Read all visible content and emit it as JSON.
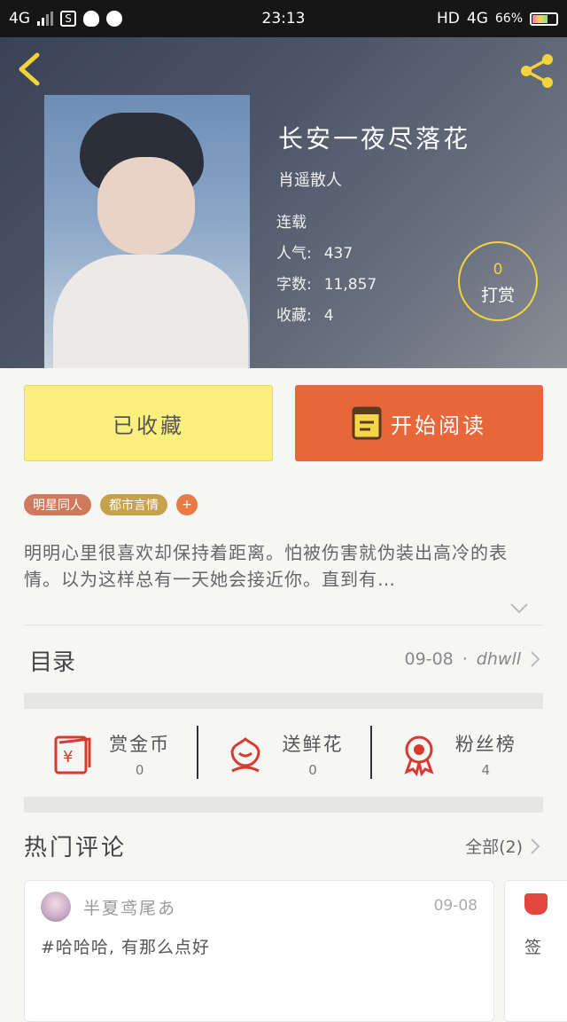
{
  "status_bar": {
    "network_left": "4G",
    "time": "23:13",
    "hd": "HD",
    "network_right": "4G",
    "battery": "66%",
    "battery_level": 0.66,
    "app_icon_1": "S"
  },
  "header": {
    "back_icon": "chevron-left-icon",
    "share_icon": "share-icon"
  },
  "book": {
    "title": "长安一夜尽落花",
    "author": "肖遥散人",
    "status": "连载",
    "popularity_label": "人气:",
    "popularity": "437",
    "words_label": "字数:",
    "words": "11,857",
    "favorites_label": "收藏:",
    "favorites": "4",
    "reward_count": "0",
    "reward_label": "打赏"
  },
  "actions": {
    "collected_label": "已收藏",
    "read_label": "开始阅读"
  },
  "tags": [
    "明星同人",
    "都市言情"
  ],
  "tag_add": "+",
  "description": "明明心里很喜欢却保持着距离。怕被伤害就伪装出高冷的表情。以为这样总有一天她会接近你。直到有…",
  "toc": {
    "title": "目录",
    "date": "09-08",
    "separator": "·",
    "latest": "dhwll"
  },
  "stats": [
    {
      "label": "赏金币",
      "value": "0",
      "icon": "red-envelope-icon"
    },
    {
      "label": "送鲜花",
      "value": "0",
      "icon": "flower-icon"
    },
    {
      "label": "粉丝榜",
      "value": "4",
      "icon": "medal-icon"
    }
  ],
  "hot_comments": {
    "title": "热门评论",
    "all_label": "全部(2)",
    "items": [
      {
        "user": "半夏鸢尾あ",
        "date": "09-08",
        "text": "#哈哈哈, 有那么点好"
      }
    ],
    "peek_text": "签"
  },
  "colors": {
    "accent_yellow": "#f3d33c",
    "collected_bg": "#fbf07c",
    "read_bg": "#e8673a",
    "icon_red": "#d93a2f"
  }
}
